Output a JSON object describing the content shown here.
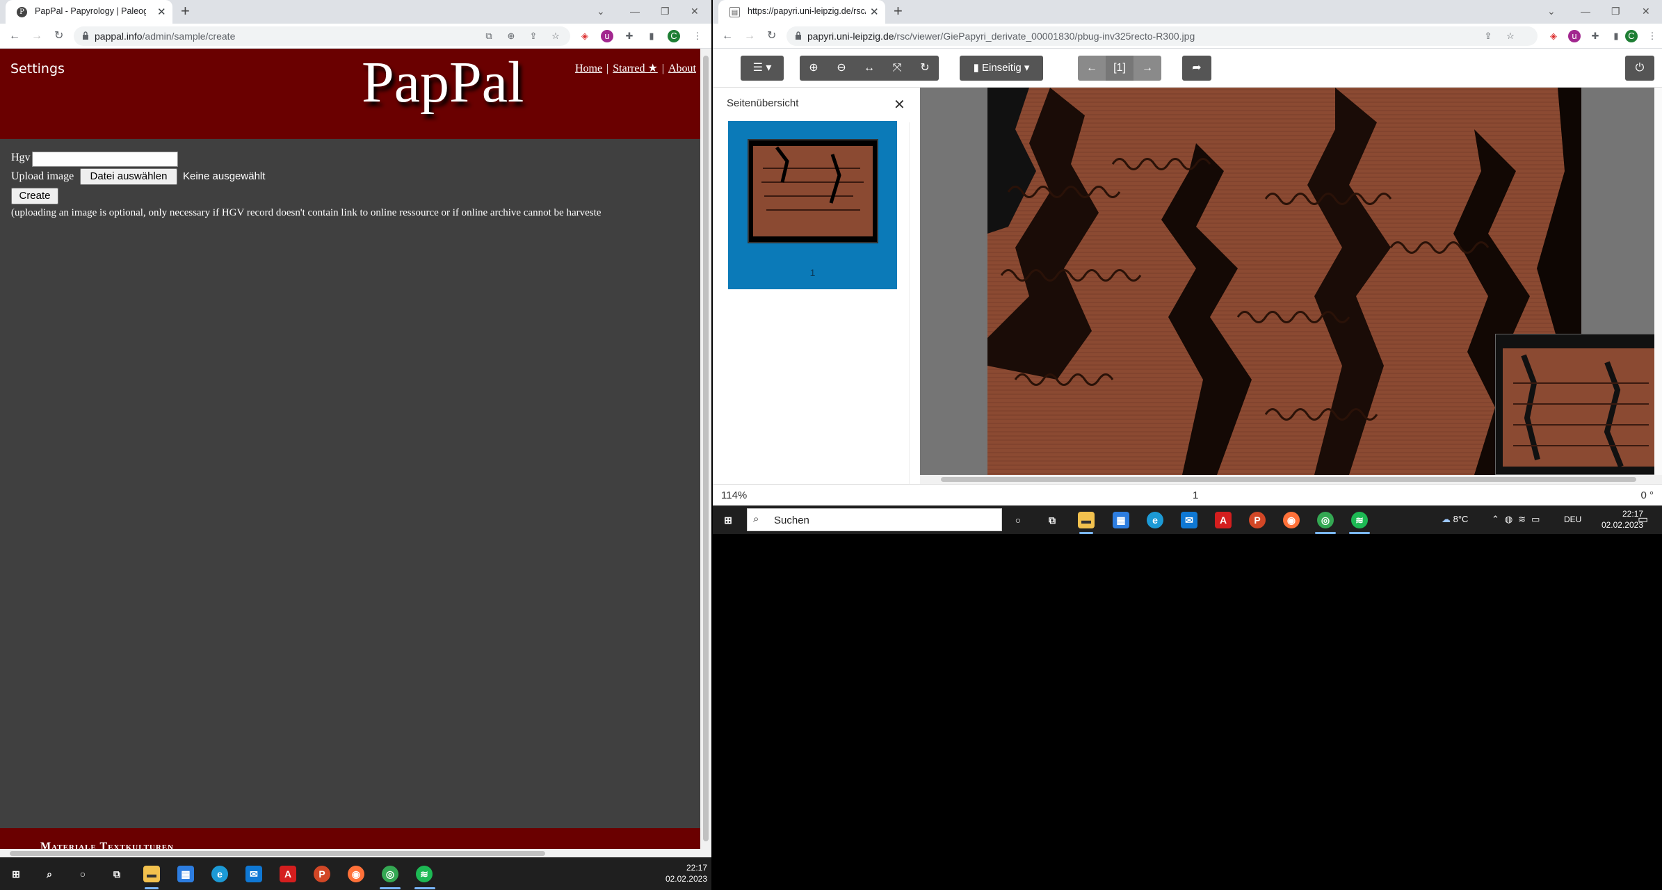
{
  "left_browser": {
    "tab_title": "PapPal - Papyrology | Paleograph",
    "url_host": "pappal.info",
    "url_path": "/admin/sample/create",
    "profile_initial": "C",
    "page": {
      "settings_label": "Settings",
      "logo": "PapPal",
      "nav": [
        "Home",
        "Starred ★",
        "About"
      ],
      "nav_separator": "|",
      "hgv_label": "Hgv",
      "hgv_value": "",
      "upload_label": "Upload image",
      "choose_file_button": "Datei auswählen",
      "no_file_text": "Keine ausgewählt",
      "create_button": "Create",
      "note": "(uploading an image is optional, only necessary if HGV record doesn't contain link to online ressource or if online archive cannot be harveste",
      "footer_text": "Materiale Textkulturen"
    }
  },
  "right_browser": {
    "tab_title": "https://papyri.uni-leipzig.de/rsc/",
    "url_host": "papyri.uni-leipzig.de",
    "url_path": "/rsc/viewer/GiePapyri_derivate_00001830/pbug-inv325recto-R300.jpg",
    "profile_initial": "C",
    "viewer": {
      "single_page_label": "Einseitig",
      "page_indicator": "[1]",
      "sidebar_title": "Seitenübersicht",
      "thumbnail_page": "1",
      "zoom": "114%",
      "current_page": "1",
      "rotation": "0 °"
    }
  },
  "taskbar_small": {
    "time": "22:17",
    "date": "02.02.2023"
  },
  "taskbar_main": {
    "search_placeholder": "Suchen",
    "weather": "8°C",
    "language": "DEU",
    "time": "22:17",
    "date": "02.02.2023"
  },
  "colors": {
    "header_red": "#6a0000",
    "page_bg": "#404040",
    "thumb_blue": "#0b7ab8"
  }
}
